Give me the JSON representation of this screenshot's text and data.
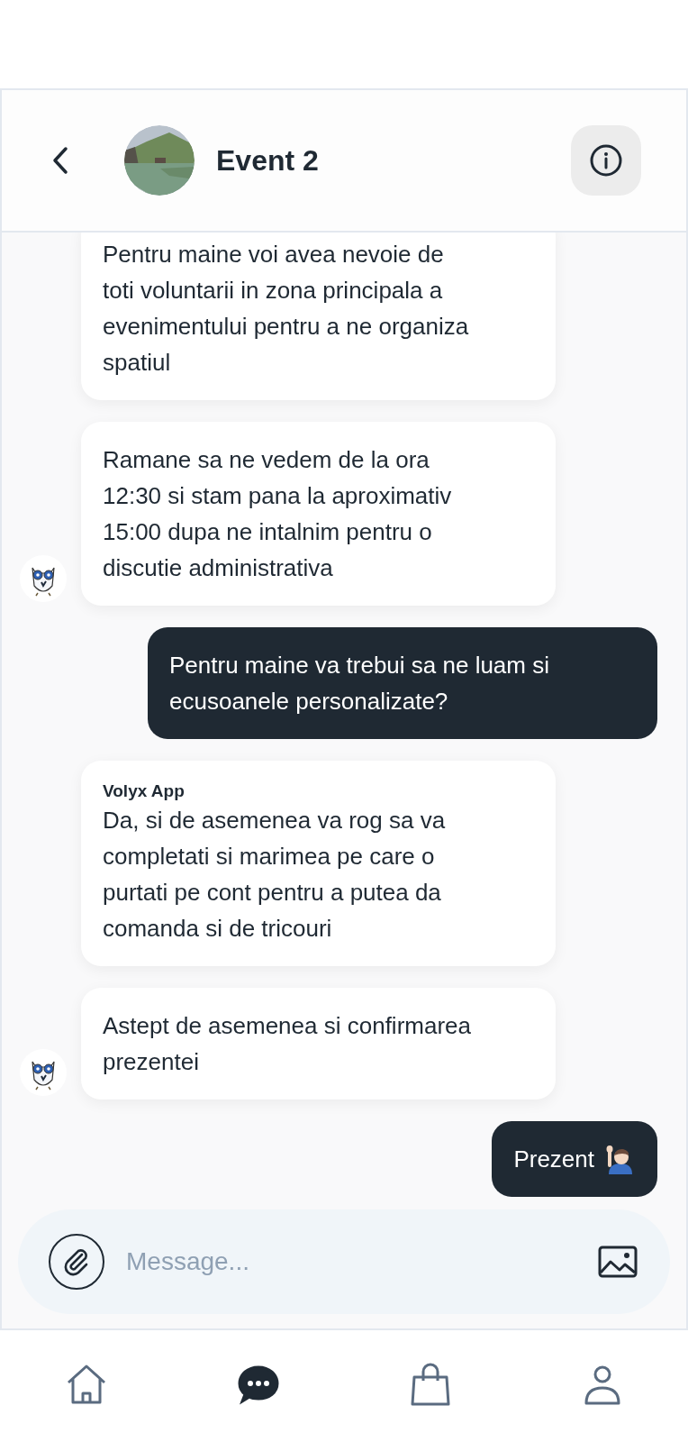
{
  "header": {
    "title": "Event 2"
  },
  "messages": [
    {
      "kind": "received",
      "show_avatar": false,
      "text": "Pentru maine voi avea nevoie de toti voluntarii in zona principala a evenimentului pentru a ne organiza spatiul"
    },
    {
      "kind": "received",
      "show_avatar": true,
      "text": "Ramane sa ne vedem de la ora 12:30 si stam pana la aproximativ 15:00 dupa ne intalnim pentru o discutie administrativa"
    },
    {
      "kind": "sent",
      "text": "Pentru maine va trebui sa ne luam si ecusoanele personalizate?"
    },
    {
      "kind": "received",
      "show_avatar": false,
      "sender": "Volyx App",
      "text": "Da, si de asemenea va rog sa va completati si marimea pe care o purtati pe cont pentru a putea da comanda si de tricouri"
    },
    {
      "kind": "received",
      "show_avatar": true,
      "text": "Astept de asemenea si confirmarea prezentei"
    },
    {
      "kind": "sent_with_emoji",
      "text": "Prezent"
    }
  ],
  "composer": {
    "placeholder": "Message..."
  },
  "nav": [
    {
      "kind": "home",
      "selected": false
    },
    {
      "kind": "chat",
      "selected": true
    },
    {
      "kind": "shop",
      "selected": false
    },
    {
      "kind": "profile",
      "selected": false
    }
  ]
}
